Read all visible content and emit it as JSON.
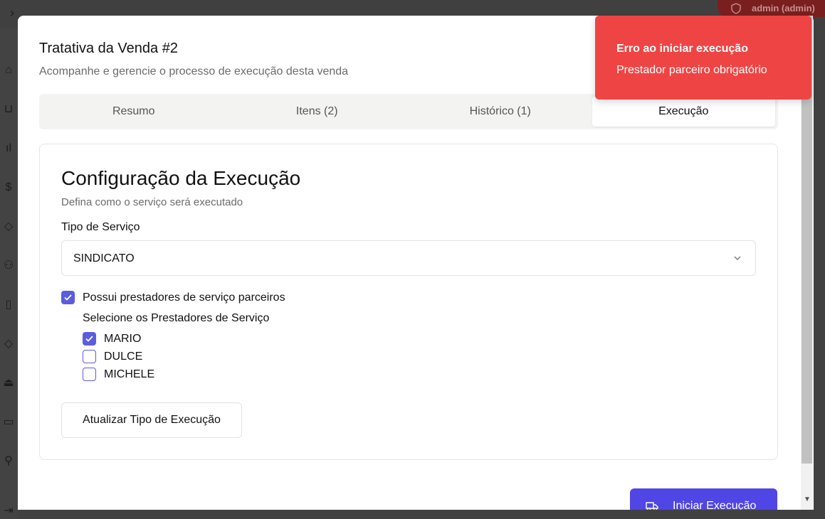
{
  "app": {
    "user_badge": "admin (admin)"
  },
  "modal": {
    "title": "Tratativa da Venda #2",
    "subtitle": "Acompanhe e gerencie o processo de execução desta venda",
    "tabs": [
      {
        "label": "Resumo",
        "active": false
      },
      {
        "label": "Itens (2)",
        "active": false
      },
      {
        "label": "Histórico (1)",
        "active": false
      },
      {
        "label": "Execução",
        "active": true
      }
    ],
    "card": {
      "title": "Configuração da Execução",
      "subtitle": "Defina como o serviço será executado",
      "service_type_label": "Tipo de Serviço",
      "service_type_value": "SINDICATO",
      "partners_checkbox_label": "Possui prestadores de serviço parceiros",
      "partners_checked": true,
      "providers_label": "Selecione os Prestadores de Serviço",
      "providers": [
        {
          "name": "MARIO",
          "checked": true
        },
        {
          "name": "DULCE",
          "checked": false
        },
        {
          "name": "MICHELE",
          "checked": false
        }
      ],
      "update_button": "Atualizar Tipo de Execução"
    },
    "start_button": "Iniciar Execução"
  },
  "toast": {
    "title": "Erro ao iniciar execução",
    "message": "Prestador parceiro obrigatório",
    "color": "#ef4444"
  },
  "colors": {
    "accent": "#5b5ce0",
    "primary_button": "#5046e5"
  }
}
